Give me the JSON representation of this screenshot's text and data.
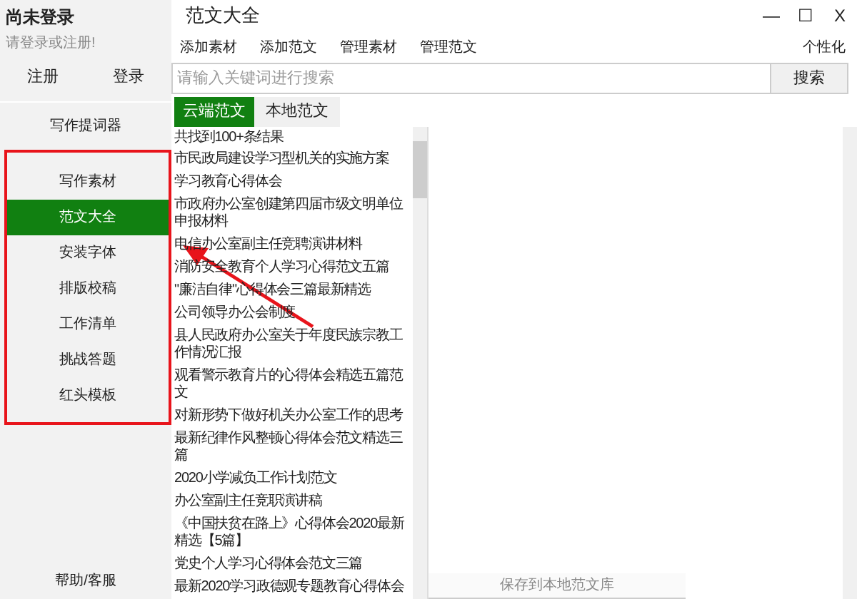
{
  "user": {
    "status": "尚未登录",
    "hint": "请登录或注册!",
    "buttons": [
      "注册",
      "登录"
    ]
  },
  "sidebar": {
    "top_item": "写作提词器",
    "items": [
      {
        "label": "写作素材",
        "selected": false
      },
      {
        "label": "范文大全",
        "selected": true
      },
      {
        "label": "安装字体",
        "selected": false
      },
      {
        "label": "排版校稿",
        "selected": false
      },
      {
        "label": "工作清单",
        "selected": false
      },
      {
        "label": "挑战答题",
        "selected": false
      },
      {
        "label": "红头模板",
        "selected": false
      }
    ],
    "help": "帮助/客服"
  },
  "window": {
    "title": "范文大全",
    "controls": [
      "—",
      "☐",
      "X"
    ]
  },
  "toolbar": {
    "items": [
      "添加素材",
      "添加范文",
      "管理素材",
      "管理范文"
    ],
    "right": "个性化"
  },
  "search": {
    "placeholder": "请输入关键词进行搜索",
    "button": "搜索"
  },
  "tabs": [
    {
      "label": "云端范文",
      "selected": true
    },
    {
      "label": "本地范文",
      "selected": false
    }
  ],
  "results": {
    "count": "共找到100+条结果",
    "items": [
      "市民政局建设学习型机关的实施方案",
      "学习教育心得体会",
      "市政府办公室创建第四届市级文明单位申报材料",
      "电信办公室副主任竞聘演讲材料",
      "消防安全教育个人学习心得范文五篇",
      "\"廉洁自律\"心得体会三篇最新精选",
      "公司领导办公会制度",
      "县人民政府办公室关于年度民族宗教工作情况汇报",
      "观看警示教育片的心得体会精选五篇范文",
      "对新形势下做好机关办公室工作的思考",
      "最新纪律作风整顿心得体会范文精选三篇",
      "2020小学减负工作计划范文",
      "办公室副主任竞职演讲稿",
      "《中国扶贫在路上》心得体会2020最新精选【5篇】",
      "党史个人学习心得体会范文三篇",
      "最新2020学习政德观专题教育心得体会"
    ]
  },
  "preview": {
    "save_button": "保存到本地范文库"
  }
}
